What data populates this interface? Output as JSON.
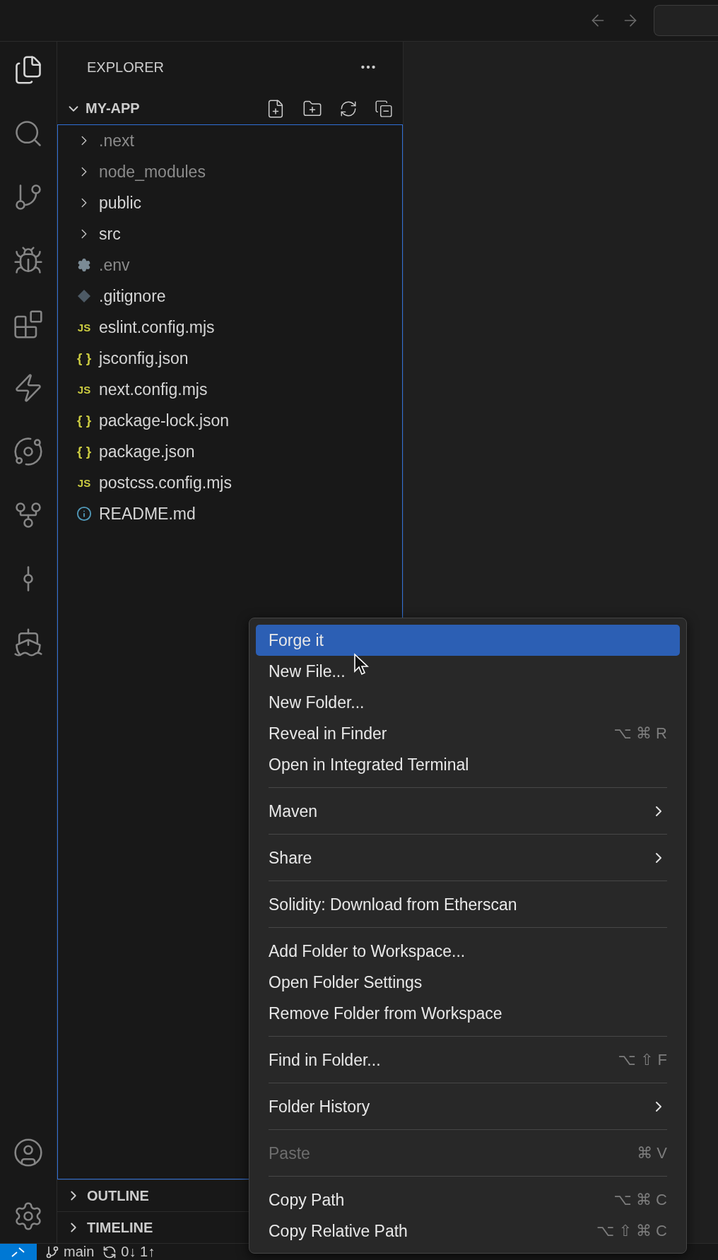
{
  "explorer": {
    "title": "EXPLORER",
    "folder": {
      "name": "MY-APP",
      "expanded": true
    }
  },
  "tree": [
    {
      "kind": "folder",
      "name": ".next",
      "dimmed": true
    },
    {
      "kind": "folder",
      "name": "node_modules",
      "dimmed": true
    },
    {
      "kind": "folder",
      "name": "public",
      "dimmed": false
    },
    {
      "kind": "folder",
      "name": "src",
      "dimmed": false
    },
    {
      "kind": "settings",
      "name": ".env",
      "dimmed": true
    },
    {
      "kind": "git",
      "name": ".gitignore",
      "dimmed": false
    },
    {
      "kind": "js",
      "icon": "JS",
      "name": "eslint.config.mjs",
      "dimmed": false
    },
    {
      "kind": "json",
      "icon": "{ }",
      "name": "jsconfig.json",
      "dimmed": false
    },
    {
      "kind": "js",
      "icon": "JS",
      "name": "next.config.mjs",
      "dimmed": false
    },
    {
      "kind": "json",
      "icon": "{ }",
      "name": "package-lock.json",
      "dimmed": false
    },
    {
      "kind": "json",
      "icon": "{ }",
      "name": "package.json",
      "dimmed": false
    },
    {
      "kind": "js",
      "icon": "JS",
      "name": "postcss.config.mjs",
      "dimmed": false
    },
    {
      "kind": "info",
      "name": "README.md",
      "dimmed": false
    }
  ],
  "panels": [
    {
      "title": "OUTLINE",
      "expanded": false
    },
    {
      "title": "TIMELINE",
      "expanded": false
    }
  ],
  "status_bar": {
    "branch": "main",
    "sync": "0↓ 1↑"
  },
  "context_menu": [
    {
      "kind": "item",
      "label": "Forge it",
      "selected": true,
      "disabled": false,
      "submenu": false
    },
    {
      "kind": "item",
      "label": "New File...",
      "selected": false,
      "disabled": false,
      "submenu": false
    },
    {
      "kind": "item",
      "label": "New Folder...",
      "selected": false,
      "disabled": false,
      "submenu": false
    },
    {
      "kind": "item",
      "label": "Reveal in Finder",
      "shortcut": "⌥ ⌘ R",
      "selected": false,
      "disabled": false,
      "submenu": false
    },
    {
      "kind": "item",
      "label": "Open in Integrated Terminal",
      "selected": false,
      "disabled": false,
      "submenu": false
    },
    {
      "kind": "separator"
    },
    {
      "kind": "item",
      "label": "Maven",
      "selected": false,
      "disabled": false,
      "submenu": true
    },
    {
      "kind": "separator"
    },
    {
      "kind": "item",
      "label": "Share",
      "selected": false,
      "disabled": false,
      "submenu": true
    },
    {
      "kind": "separator"
    },
    {
      "kind": "item",
      "label": "Solidity: Download from Etherscan",
      "selected": false,
      "disabled": false,
      "submenu": false
    },
    {
      "kind": "separator"
    },
    {
      "kind": "item",
      "label": "Add Folder to Workspace...",
      "selected": false,
      "disabled": false,
      "submenu": false
    },
    {
      "kind": "item",
      "label": "Open Folder Settings",
      "selected": false,
      "disabled": false,
      "submenu": false
    },
    {
      "kind": "item",
      "label": "Remove Folder from Workspace",
      "selected": false,
      "disabled": false,
      "submenu": false
    },
    {
      "kind": "separator"
    },
    {
      "kind": "item",
      "label": "Find in Folder...",
      "shortcut": "⌥ ⇧ F",
      "selected": false,
      "disabled": false,
      "submenu": false
    },
    {
      "kind": "separator"
    },
    {
      "kind": "item",
      "label": "Folder History",
      "selected": false,
      "disabled": false,
      "submenu": true
    },
    {
      "kind": "separator"
    },
    {
      "kind": "item",
      "label": "Paste",
      "shortcut": "⌘ V",
      "selected": false,
      "disabled": true,
      "submenu": false
    },
    {
      "kind": "separator"
    },
    {
      "kind": "item",
      "label": "Copy Path",
      "shortcut": "⌥ ⌘ C",
      "selected": false,
      "disabled": false,
      "submenu": false
    },
    {
      "kind": "item",
      "label": "Copy Relative Path",
      "shortcut": "⌥ ⇧ ⌘ C",
      "selected": false,
      "disabled": false,
      "submenu": false
    }
  ]
}
